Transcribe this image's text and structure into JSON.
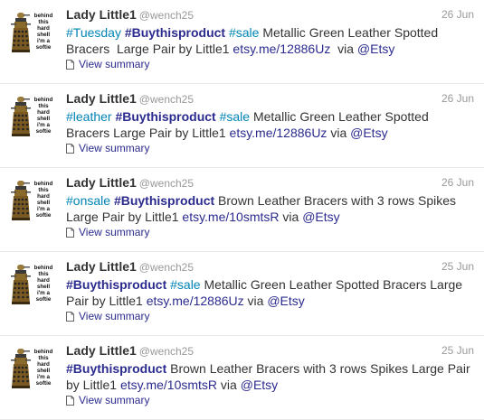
{
  "tweets": [
    {
      "fullname": "Lady Little1",
      "username": "@wench25",
      "time": "26 Jun",
      "parts": [
        {
          "t": "hashtag",
          "v": "#Tuesday"
        },
        {
          "t": "text",
          "v": " "
        },
        {
          "t": "hashtag_strong",
          "v": "#Buythisproduct"
        },
        {
          "t": "text",
          "v": " "
        },
        {
          "t": "hashtag",
          "v": "#sale"
        },
        {
          "t": "text",
          "v": " Metallic Green Leather Spotted Bracers  Large Pair by Little1 "
        },
        {
          "t": "link",
          "v": "etsy.me/12886Uz"
        },
        {
          "t": "text",
          "v": "  via "
        },
        {
          "t": "mention",
          "v": "@Etsy"
        }
      ],
      "summary": "View summary"
    },
    {
      "fullname": "Lady Little1",
      "username": "@wench25",
      "time": "26 Jun",
      "parts": [
        {
          "t": "hashtag",
          "v": "#leather"
        },
        {
          "t": "text",
          "v": " "
        },
        {
          "t": "hashtag_strong",
          "v": "#Buythisproduct"
        },
        {
          "t": "text",
          "v": " "
        },
        {
          "t": "hashtag",
          "v": "#sale"
        },
        {
          "t": "text",
          "v": " Metallic Green Leather Spotted Bracers Large Pair by Little1 "
        },
        {
          "t": "link",
          "v": "etsy.me/12886Uz"
        },
        {
          "t": "text",
          "v": " via "
        },
        {
          "t": "mention",
          "v": "@Etsy"
        }
      ],
      "summary": "View summary"
    },
    {
      "fullname": "Lady Little1",
      "username": "@wench25",
      "time": "26 Jun",
      "parts": [
        {
          "t": "hashtag",
          "v": "#onsale"
        },
        {
          "t": "text",
          "v": " "
        },
        {
          "t": "hashtag_strong",
          "v": "#Buythisproduct"
        },
        {
          "t": "text",
          "v": " Brown Leather Bracers with 3 rows Spikes Large Pair by Little1 "
        },
        {
          "t": "link",
          "v": "etsy.me/10smtsR"
        },
        {
          "t": "text",
          "v": " via "
        },
        {
          "t": "mention",
          "v": "@Etsy"
        }
      ],
      "summary": "View summary"
    },
    {
      "fullname": "Lady Little1",
      "username": "@wench25",
      "time": "25 Jun",
      "parts": [
        {
          "t": "hashtag_strong",
          "v": "#Buythisproduct"
        },
        {
          "t": "text",
          "v": " "
        },
        {
          "t": "hashtag",
          "v": "#sale"
        },
        {
          "t": "text",
          "v": " Metallic Green Leather Spotted Bracers Large Pair by Little1 "
        },
        {
          "t": "link",
          "v": "etsy.me/12886Uz"
        },
        {
          "t": "text",
          "v": " via "
        },
        {
          "t": "mention",
          "v": "@Etsy"
        }
      ],
      "summary": "View summary"
    },
    {
      "fullname": "Lady Little1",
      "username": "@wench25",
      "time": "25 Jun",
      "parts": [
        {
          "t": "hashtag_strong",
          "v": "#Buythisproduct"
        },
        {
          "t": "text",
          "v": " Brown Leather Bracers with 3 rows Spikes Large Pair by Little1 "
        },
        {
          "t": "link",
          "v": "etsy.me/10smtsR"
        },
        {
          "t": "text",
          "v": " via "
        },
        {
          "t": "mention",
          "v": "@Etsy"
        }
      ],
      "summary": "View summary"
    }
  ],
  "avatar": {
    "caption": [
      "behind",
      "this",
      "hard",
      "shell",
      "i'm a",
      "softie"
    ],
    "icon": "dalek-avatar"
  },
  "colors": {
    "hashtag": "#0084b4",
    "hashtag_strong": "#2b2b8f",
    "link": "#2b2b8f",
    "meta": "#999999",
    "divider": "#e8e8e8"
  }
}
